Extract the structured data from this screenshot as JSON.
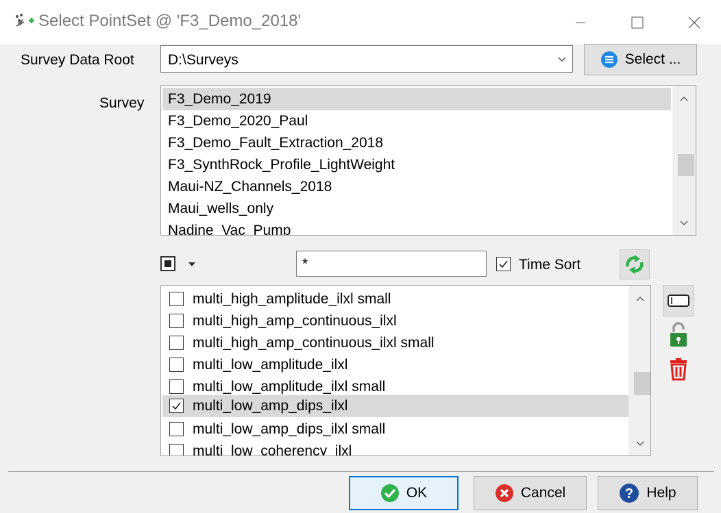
{
  "window": {
    "title": "Select PointSet @ 'F3_Demo_2018'",
    "minimize_icon": "minimize-icon",
    "maximize_icon": "maximize-icon",
    "close_icon": "close-icon"
  },
  "survey_root": {
    "label": "Survey Data Root",
    "value": "D:\\Surveys",
    "select_button": "Select ..."
  },
  "survey": {
    "label": "Survey",
    "items": [
      "F3_Demo_2019",
      "F3_Demo_2020_Paul",
      "F3_Demo_Fault_Extraction_2018",
      "F3_SynthRock_Profile_LightWeight",
      "Maui-NZ_Channels_2018",
      "Maui_wells_only",
      "Nadine_Vac_Pump"
    ],
    "selected_index": 0
  },
  "filter": {
    "value": "*",
    "time_sort_label": "Time Sort",
    "time_sort_checked": true
  },
  "pointsets": {
    "items": [
      {
        "name": "multi_high_amplitude_ilxl small",
        "checked": false
      },
      {
        "name": "multi_high_amp_continuous_ilxl",
        "checked": false
      },
      {
        "name": "multi_high_amp_continuous_ilxl small",
        "checked": false
      },
      {
        "name": "multi_low_amplitude_ilxl",
        "checked": false
      },
      {
        "name": "multi_low_amplitude_ilxl small",
        "checked": false
      },
      {
        "name": "multi_low_amp_dips_ilxl",
        "checked": true
      },
      {
        "name": "multi_low_amp_dips_ilxl small",
        "checked": false
      },
      {
        "name": "multi_low_coherency_ilxl",
        "checked": false
      }
    ],
    "selected_index": 5
  },
  "buttons": {
    "ok": "OK",
    "cancel": "Cancel",
    "help": "Help"
  },
  "colors": {
    "accent": "#0078d7",
    "ok_green": "#2eb24a",
    "cancel_red": "#d9302c",
    "help_blue": "#1f4f9c",
    "delete_red": "#e0201a",
    "lock_green": "#2e8b3a"
  }
}
